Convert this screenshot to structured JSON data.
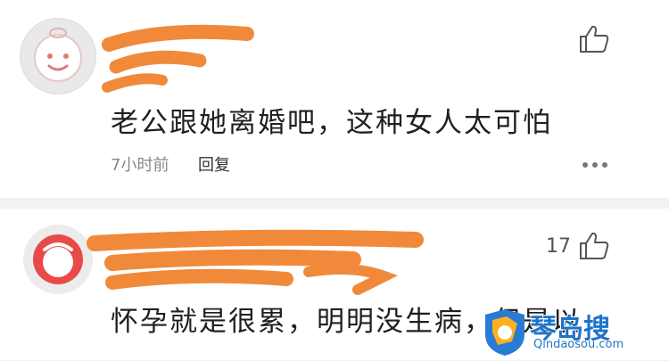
{
  "comments": [
    {
      "text": "老公跟她离婚吧，这种女人太可怕",
      "time": "7小时前",
      "reply_label": "回复",
      "likes": ""
    },
    {
      "text": "怀孕就是很累，明明没生病，但是以",
      "likes": "17"
    }
  ],
  "watermark": {
    "brand": "琴岛搜",
    "url": "Qindaosou.com"
  },
  "colors": {
    "redaction": "#f08a3a",
    "watermark_blue": "#1e73c8",
    "avatar2_red": "#e84a4a"
  },
  "icons": [
    "avatar-icon",
    "thumbs-up-icon",
    "more-icon",
    "watermark-logo-icon"
  ]
}
